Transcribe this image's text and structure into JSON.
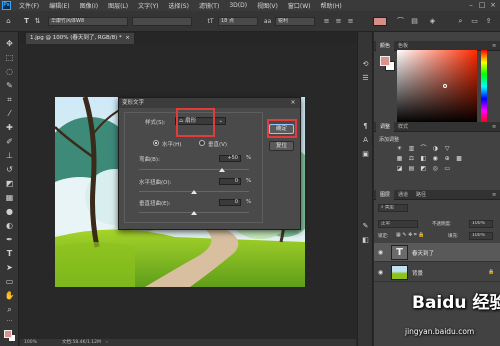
{
  "app": {
    "logo": "Ps"
  },
  "menu": [
    "文件(F)",
    "编辑(E)",
    "图像(I)",
    "图层(L)",
    "文字(Y)",
    "选择(S)",
    "滤镜(T)",
    "3D(D)",
    "视图(V)",
    "窗口(W)",
    "帮助(H)"
  ],
  "options_bar": {
    "font_family": "华康竹风体W8",
    "font_size": "18 点",
    "anti_alias": "锐利",
    "text_color": "#d58f86"
  },
  "document": {
    "tab_title": "1.jpg @ 100% (春天到了, RGB/8) *"
  },
  "status_bar": {
    "zoom": "100%",
    "doc_info": "文档:58.4K/1.12M"
  },
  "warp_dialog": {
    "title": "变形文字",
    "style_label": "样式(S):",
    "style_value": "扇形",
    "horizontal_label": "水平(H)",
    "vertical_label": "垂直(V)",
    "orientation": "horizontal",
    "bend_label": "弯曲(B):",
    "bend_value": "+50",
    "h_distort_label": "水平扭曲(O):",
    "h_distort_value": "0",
    "v_distort_label": "垂直扭曲(E):",
    "v_distort_value": "0",
    "percent": "%",
    "ok_label": "确定",
    "reset_label": "复位",
    "bend_level": 0.75,
    "h_distort_level": 0.5,
    "v_distort_level": 0.5
  },
  "color_panel": {
    "tabs": [
      "颜色",
      "色板"
    ],
    "foreground": "#d9938a",
    "background": "#ffffff"
  },
  "adjustments_panel": {
    "tabs": [
      "调整",
      "样式"
    ],
    "subtitle": "添加调整"
  },
  "layers_panel": {
    "tabs": [
      "图层",
      "通道",
      "路径"
    ],
    "kind_label": "类型",
    "blend_mode": "正常",
    "opacity_label": "不透明度:",
    "opacity_value": "100%",
    "lock_label": "锁定:",
    "fill_label": "填充:",
    "fill_value": "100%",
    "layers": [
      {
        "name": "春天到了",
        "type": "text",
        "selected": true
      },
      {
        "name": "背景",
        "type": "image",
        "selected": false
      }
    ]
  },
  "watermark": {
    "brand": "Baidu 经验",
    "url": "jingyan.baidu.com"
  }
}
